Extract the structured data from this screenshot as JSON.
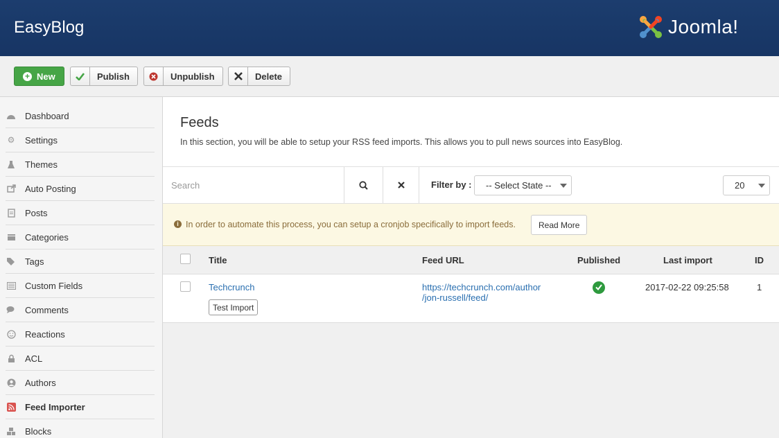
{
  "header": {
    "title": "EasyBlog",
    "brand": "Joomla!"
  },
  "toolbar": {
    "new": "New",
    "publish": "Publish",
    "unpublish": "Unpublish",
    "delete": "Delete"
  },
  "sidebar": {
    "items": [
      {
        "label": "Dashboard",
        "icon": "dashboard-icon"
      },
      {
        "label": "Settings",
        "icon": "gear-icon"
      },
      {
        "label": "Themes",
        "icon": "flask-icon"
      },
      {
        "label": "Auto Posting",
        "icon": "share-icon"
      },
      {
        "label": "Posts",
        "icon": "document-icon"
      },
      {
        "label": "Categories",
        "icon": "folder-icon"
      },
      {
        "label": "Tags",
        "icon": "tags-icon"
      },
      {
        "label": "Custom Fields",
        "icon": "list-icon"
      },
      {
        "label": "Comments",
        "icon": "comments-icon"
      },
      {
        "label": "Reactions",
        "icon": "smile-icon"
      },
      {
        "label": "ACL",
        "icon": "lock-icon"
      },
      {
        "label": "Authors",
        "icon": "user-icon"
      },
      {
        "label": "Feed Importer",
        "icon": "rss-icon",
        "active": true
      },
      {
        "label": "Blocks",
        "icon": "blocks-icon"
      }
    ]
  },
  "page": {
    "title": "Feeds",
    "description": "In this section, you will be able to setup your RSS feed imports. This allows you to pull news sources into EasyBlog."
  },
  "filters": {
    "search_placeholder": "Search",
    "filter_label": "Filter by :",
    "state_select": "-- Select State --",
    "limit": "20"
  },
  "notice": {
    "text": "In order to automate this process, you can setup a cronjob specifically to import feeds.",
    "button": "Read More"
  },
  "table": {
    "columns": {
      "title": "Title",
      "feed_url": "Feed URL",
      "published": "Published",
      "last_import": "Last import",
      "id": "ID"
    },
    "rows": [
      {
        "title": "Techcrunch",
        "action": "Test Import",
        "feed_url_line1": "https://techcrunch.com/author",
        "feed_url_line2": "/jon-russell/feed/",
        "published": true,
        "last_import": "2017-02-22 09:25:58",
        "id": "1"
      }
    ]
  },
  "colors": {
    "header_bg": "#173564",
    "new_button": "#46a546",
    "published_green": "#2e9a3e",
    "rss_red": "#d9534f",
    "link": "#2a6fb0",
    "notice_bg": "#fcf8e3"
  }
}
